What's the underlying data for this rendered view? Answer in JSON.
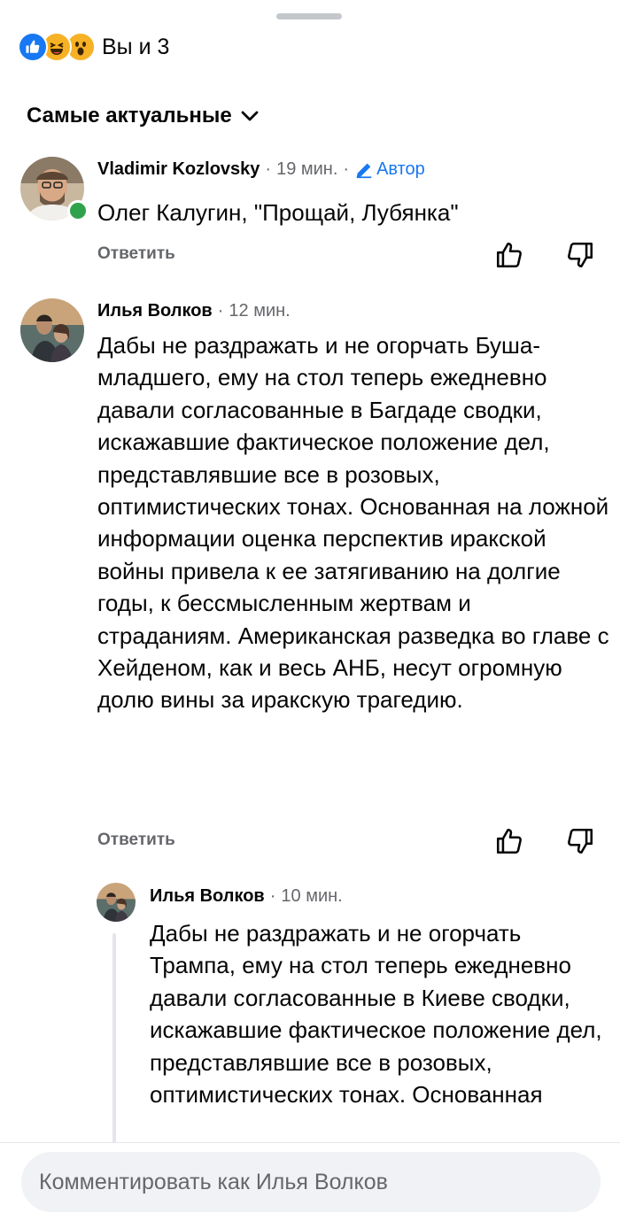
{
  "reactions": {
    "icons": [
      "like-icon",
      "haha-icon",
      "wow-icon"
    ],
    "text": "Вы и 3"
  },
  "sort": {
    "label": "Самые актуальные"
  },
  "comments": [
    {
      "author": "Vladimir Kozlovsky",
      "time": "19 мин.",
      "badge": "Автор",
      "text": "Олег Калугин, \"Прощай, Лубянка\"",
      "reply_label": "Ответить",
      "online": true
    },
    {
      "author": "Илья Волков",
      "time": "12 мин.",
      "text": "Дабы не раздражать и не огорчать Буша-младшего, ему на стол теперь ежедневно давали согласованные в Багдаде сводки, искажавшие фактическое положение дел, представлявшие все в розовых, оптимистических тонах. Основанная на ложной информации оценка перспектив иракской войны привела к ее затягиванию на долгие годы, к бессмысленным жертвам и страданиям. Американская разведка во главе с Хейденом, как и весь АНБ, несут огромную долю вины за иракскую трагедию.",
      "reply_label": "Ответить"
    },
    {
      "author": "Илья Волков",
      "time": "10 мин.",
      "text": "Дабы не раздражать и не огорчать Трампа, ему на стол теперь ежедневно давали согласованные в Киеве сводки, искажавшие фактическое положение дел, представлявшие все в розовых, оптимистических тонах. Основанная"
    }
  ],
  "composer": {
    "placeholder": "Комментировать как Илья Волков"
  },
  "colors": {
    "accent": "#1877f2",
    "online": "#31a24c",
    "muted": "#65676b"
  }
}
